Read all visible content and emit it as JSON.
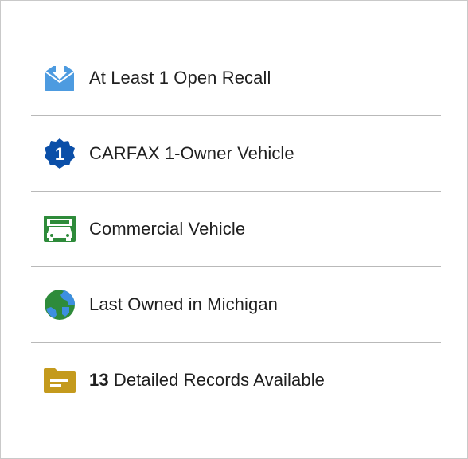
{
  "colors": {
    "recall_icon": "#4d9be0",
    "owner_badge": "#0b4fa8",
    "commercial_icon": "#2e8b3a",
    "globe_land": "#2e8b3a",
    "globe_water": "#3d8fe0",
    "folder_icon": "#c49a1d",
    "divider": "#b9b9b9",
    "text": "#1f1f1f"
  },
  "items": [
    {
      "icon": "recall-envelope-icon",
      "label": "At Least 1 Open Recall"
    },
    {
      "icon": "one-owner-badge-icon",
      "badge_text": "1",
      "label": "CARFAX 1-Owner Vehicle"
    },
    {
      "icon": "commercial-truck-icon",
      "label": "Commercial Vehicle"
    },
    {
      "icon": "globe-icon",
      "label": "Last Owned in Michigan"
    },
    {
      "icon": "folder-icon",
      "count": "13",
      "label": "Detailed Records Available"
    }
  ]
}
